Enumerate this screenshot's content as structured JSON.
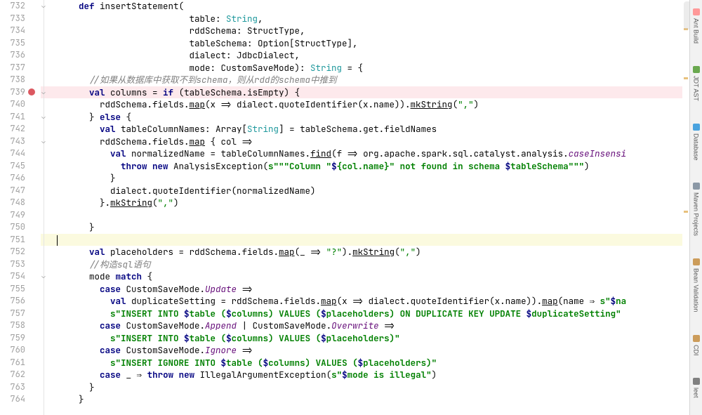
{
  "editor": {
    "startLine": 732,
    "breakpointLine": 739,
    "currentLine": 751,
    "lines": [
      {
        "n": 732,
        "seg": [
          {
            "c": "kw",
            "t": "    def"
          },
          {
            "t": " insertStatement("
          }
        ]
      },
      {
        "n": 733,
        "seg": [
          {
            "t": "                         table: "
          },
          {
            "c": "typ",
            "t": "String"
          },
          {
            "t": ","
          }
        ]
      },
      {
        "n": 734,
        "seg": [
          {
            "t": "                         rddSchema: StructType,"
          }
        ]
      },
      {
        "n": 735,
        "seg": [
          {
            "t": "                         tableSchema: Option[StructType],"
          }
        ]
      },
      {
        "n": 736,
        "seg": [
          {
            "t": "                         dialect: JdbcDialect,"
          }
        ]
      },
      {
        "n": 737,
        "seg": [
          {
            "t": "                         mode: CustomSaveMode): "
          },
          {
            "c": "typ",
            "t": "String"
          },
          {
            "t": " = {"
          }
        ]
      },
      {
        "n": 738,
        "seg": [
          {
            "t": "      "
          },
          {
            "c": "cmt",
            "t": "//如果从数据库中获取不到schema，则从rdd的schema中推到"
          }
        ]
      },
      {
        "n": 739,
        "seg": [
          {
            "t": "      "
          },
          {
            "c": "kw",
            "t": "val"
          },
          {
            "t": " columns = "
          },
          {
            "c": "kw",
            "t": "if"
          },
          {
            "t": " (tableSchema.isEmpty) {"
          }
        ]
      },
      {
        "n": 740,
        "seg": [
          {
            "t": "        rddSchema.fields."
          },
          {
            "c": "ul",
            "t": "map"
          },
          {
            "t": "(x => dialect.quoteIdentifier(x.name))."
          },
          {
            "c": "ul",
            "t": "mkString"
          },
          {
            "t": "("
          },
          {
            "c": "strlit",
            "t": "\",\""
          },
          {
            "t": ")"
          }
        ]
      },
      {
        "n": 741,
        "seg": [
          {
            "t": "      } "
          },
          {
            "c": "kw",
            "t": "else"
          },
          {
            "t": " {"
          }
        ]
      },
      {
        "n": 742,
        "seg": [
          {
            "t": "        "
          },
          {
            "c": "kw",
            "t": "val"
          },
          {
            "t": " tableColumnNames: Array["
          },
          {
            "c": "typ",
            "t": "String"
          },
          {
            "t": "] = tableSchema.get.fieldNames"
          }
        ]
      },
      {
        "n": 743,
        "seg": [
          {
            "t": "        rddSchema.fields."
          },
          {
            "c": "ul",
            "t": "map"
          },
          {
            "t": " { col =>"
          }
        ]
      },
      {
        "n": 744,
        "seg": [
          {
            "t": "          "
          },
          {
            "c": "kw",
            "t": "val"
          },
          {
            "t": " normalizedName = tableColumnNames."
          },
          {
            "c": "ul",
            "t": "find"
          },
          {
            "t": "(f => org.apache.spark.sql.catalyst.analysis."
          },
          {
            "c": "ital",
            "t": "caseInsensi"
          }
        ]
      },
      {
        "n": 745,
        "seg": [
          {
            "t": "            "
          },
          {
            "c": "kw",
            "t": "throw new"
          },
          {
            "t": " AnalysisException("
          },
          {
            "c": "grn",
            "t": "s\"\"\"Column \""
          },
          {
            "c": "interp",
            "t": "$"
          },
          {
            "c": "grn",
            "t": "{col.name}\" not found in schema "
          },
          {
            "c": "interp",
            "t": "$"
          },
          {
            "c": "grn",
            "t": "tableSchema\"\"\""
          },
          {
            "t": ")"
          }
        ]
      },
      {
        "n": 746,
        "seg": [
          {
            "t": "          }"
          }
        ]
      },
      {
        "n": 747,
        "seg": [
          {
            "t": "          dialect.quoteIdentifier(normalizedName)"
          }
        ]
      },
      {
        "n": 748,
        "seg": [
          {
            "t": "        }."
          },
          {
            "c": "ul",
            "t": "mkString"
          },
          {
            "t": "("
          },
          {
            "c": "strlit",
            "t": "\",\""
          },
          {
            "t": ")"
          }
        ]
      },
      {
        "n": 749,
        "seg": [
          {
            "t": ""
          }
        ]
      },
      {
        "n": 750,
        "seg": [
          {
            "t": "      }"
          }
        ]
      },
      {
        "n": 751,
        "seg": [
          {
            "t": ""
          }
        ],
        "caret": true
      },
      {
        "n": 752,
        "seg": [
          {
            "t": "      "
          },
          {
            "c": "kw",
            "t": "val"
          },
          {
            "t": " placeholders = rddSchema.fields."
          },
          {
            "c": "ul",
            "t": "map"
          },
          {
            "t": "(_ => "
          },
          {
            "c": "strlit",
            "t": "\"?\""
          },
          {
            "t": ")."
          },
          {
            "c": "ul",
            "t": "mkString"
          },
          {
            "t": "("
          },
          {
            "c": "strlit",
            "t": "\",\""
          },
          {
            "t": ")"
          }
        ]
      },
      {
        "n": 753,
        "seg": [
          {
            "t": "      "
          },
          {
            "c": "cmt",
            "t": "//构造sql语句"
          }
        ]
      },
      {
        "n": 754,
        "seg": [
          {
            "t": "      mode "
          },
          {
            "c": "kw",
            "t": "match"
          },
          {
            "t": " {"
          }
        ]
      },
      {
        "n": 755,
        "seg": [
          {
            "t": "        "
          },
          {
            "c": "kw",
            "t": "case"
          },
          {
            "t": " CustomSaveMode."
          },
          {
            "c": "ital",
            "t": "Update"
          },
          {
            "t": " =>"
          }
        ]
      },
      {
        "n": 756,
        "seg": [
          {
            "t": "          "
          },
          {
            "c": "kw",
            "t": "val"
          },
          {
            "t": " duplicateSetting = rddSchema.fields."
          },
          {
            "c": "ul",
            "t": "map"
          },
          {
            "t": "(x => dialect.quoteIdentifier(x.name))."
          },
          {
            "c": "ul",
            "t": "map"
          },
          {
            "t": "(name ⇒ "
          },
          {
            "c": "grn",
            "t": "s\""
          },
          {
            "c": "interp",
            "t": "$"
          },
          {
            "c": "grn",
            "t": "na"
          }
        ]
      },
      {
        "n": 757,
        "seg": [
          {
            "t": "          "
          },
          {
            "c": "grn",
            "t": "s\"INSERT INTO "
          },
          {
            "c": "interp",
            "t": "$"
          },
          {
            "c": "grn",
            "t": "table ("
          },
          {
            "c": "interp",
            "t": "$"
          },
          {
            "c": "grn",
            "t": "columns) VALUES ("
          },
          {
            "c": "interp",
            "t": "$"
          },
          {
            "c": "grn",
            "t": "placeholders) ON DUPLICATE KEY UPDATE "
          },
          {
            "c": "interp",
            "t": "$"
          },
          {
            "c": "grn",
            "t": "duplicateSetting\""
          }
        ]
      },
      {
        "n": 758,
        "seg": [
          {
            "t": "        "
          },
          {
            "c": "kw",
            "t": "case"
          },
          {
            "t": " CustomSaveMode."
          },
          {
            "c": "ital",
            "t": "Append"
          },
          {
            "t": " | CustomSaveMode."
          },
          {
            "c": "ital",
            "t": "Overwrite"
          },
          {
            "t": " =>"
          }
        ]
      },
      {
        "n": 759,
        "seg": [
          {
            "t": "          "
          },
          {
            "c": "grn",
            "t": "s\"INSERT INTO "
          },
          {
            "c": "interp",
            "t": "$"
          },
          {
            "c": "grn",
            "t": "table ("
          },
          {
            "c": "interp",
            "t": "$"
          },
          {
            "c": "grn",
            "t": "columns) VALUES ("
          },
          {
            "c": "interp",
            "t": "$"
          },
          {
            "c": "grn",
            "t": "placeholders)\""
          }
        ]
      },
      {
        "n": 760,
        "seg": [
          {
            "t": "        "
          },
          {
            "c": "kw",
            "t": "case"
          },
          {
            "t": " CustomSaveMode."
          },
          {
            "c": "ital",
            "t": "Ignore"
          },
          {
            "t": " =>"
          }
        ]
      },
      {
        "n": 761,
        "seg": [
          {
            "t": "          "
          },
          {
            "c": "grn",
            "t": "s\"INSERT IGNORE INTO "
          },
          {
            "c": "interp",
            "t": "$"
          },
          {
            "c": "grn",
            "t": "table ("
          },
          {
            "c": "interp",
            "t": "$"
          },
          {
            "c": "grn",
            "t": "columns) VALUES ("
          },
          {
            "c": "interp",
            "t": "$"
          },
          {
            "c": "grn",
            "t": "placeholders)\""
          }
        ]
      },
      {
        "n": 762,
        "seg": [
          {
            "t": "        "
          },
          {
            "c": "kw",
            "t": "case"
          },
          {
            "t": " _ ⇒ "
          },
          {
            "c": "kw",
            "t": "throw new"
          },
          {
            "t": " IllegalArgumentException("
          },
          {
            "c": "grn",
            "t": "s\""
          },
          {
            "c": "interp",
            "t": "$"
          },
          {
            "c": "grn",
            "t": "mode is illegal\""
          },
          {
            "t": ")"
          }
        ]
      },
      {
        "n": 763,
        "seg": [
          {
            "t": "      }"
          }
        ]
      },
      {
        "n": 764,
        "seg": [
          {
            "t": "    }"
          }
        ]
      }
    ]
  },
  "sidebar": {
    "tools": [
      {
        "id": "ant-build",
        "label": "Ant Build",
        "color": "#ff9999"
      },
      {
        "id": "jdt-ast",
        "label": "JDT AST",
        "color": "#6aa84f"
      },
      {
        "id": "database",
        "label": "Database",
        "color": "#4aa3df"
      },
      {
        "id": "maven",
        "label": "Maven Projects",
        "color": "#8b98a6"
      },
      {
        "id": "bean-validation",
        "label": "Bean Validation",
        "color": "#cc9c5a"
      },
      {
        "id": "cdi",
        "label": "CDI",
        "color": "#cc9c5a"
      },
      {
        "id": "leet",
        "label": "leet",
        "color": "#808080"
      }
    ]
  }
}
